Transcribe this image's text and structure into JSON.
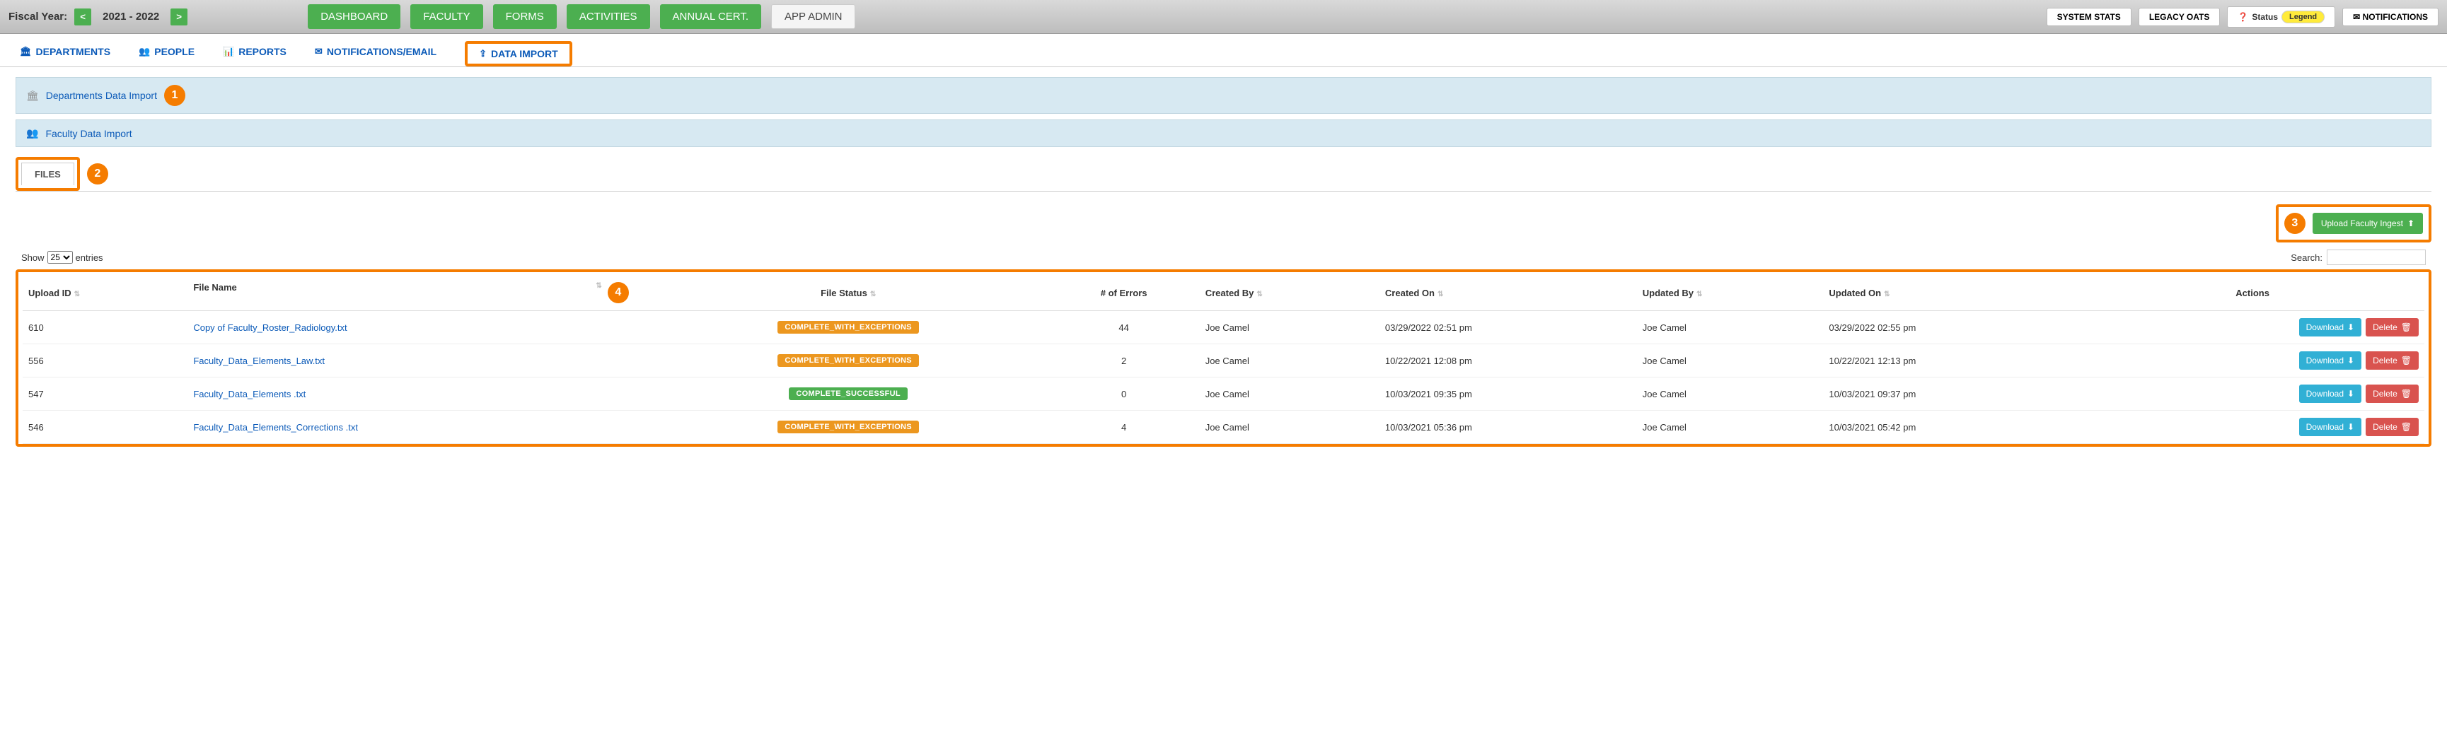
{
  "header": {
    "fiscal_label": "Fiscal Year:",
    "prev": "<",
    "year": "2021 - 2022",
    "next": ">",
    "nav": [
      "DASHBOARD",
      "FACULTY",
      "FORMS",
      "ACTIVITIES",
      "ANNUAL CERT.",
      "APP ADMIN"
    ],
    "util": {
      "system_stats": "SYSTEM STATS",
      "legacy_oats": "LEGACY OATS",
      "status_label": "Status",
      "legend": "Legend",
      "notifications": "NOTIFICATIONS"
    }
  },
  "tabs": {
    "departments": "DEPARTMENTS",
    "people": "PEOPLE",
    "reports": "REPORTS",
    "notifications_email": "NOTIFICATIONS/EMAIL",
    "data_import": "DATA IMPORT"
  },
  "import_sections": {
    "departments": "Departments Data Import",
    "faculty": "Faculty Data Import"
  },
  "files_tab": "FILES",
  "upload_btn": "Upload Faculty Ingest",
  "markers": {
    "m1": "1",
    "m2": "2",
    "m3": "3",
    "m4": "4"
  },
  "table_controls": {
    "show": "Show",
    "entries": "entries",
    "page_size": "25",
    "search": "Search:"
  },
  "columns": {
    "upload_id": "Upload ID",
    "file_name": "File Name",
    "file_status": "File Status",
    "errors": "# of Errors",
    "created_by": "Created By",
    "created_on": "Created On",
    "updated_by": "Updated By",
    "updated_on": "Updated On",
    "actions": "Actions"
  },
  "status_labels": {
    "exceptions": "COMPLETE_WITH_EXCEPTIONS",
    "successful": "COMPLETE_SUCCESSFUL"
  },
  "action_labels": {
    "download": "Download",
    "delete": "Delete"
  },
  "rows": [
    {
      "id": "610",
      "file": "Copy of Faculty_Roster_Radiology.txt",
      "status": "exceptions",
      "errors": "44",
      "created_by": "Joe Camel",
      "created_on": "03/29/2022 02:51 pm",
      "updated_by": "Joe Camel",
      "updated_on": "03/29/2022 02:55 pm"
    },
    {
      "id": "556",
      "file": "Faculty_Data_Elements_Law.txt",
      "status": "exceptions",
      "errors": "2",
      "created_by": "Joe Camel",
      "created_on": "10/22/2021 12:08 pm",
      "updated_by": "Joe Camel",
      "updated_on": "10/22/2021 12:13 pm"
    },
    {
      "id": "547",
      "file": "Faculty_Data_Elements .txt",
      "status": "successful",
      "errors": "0",
      "created_by": "Joe Camel",
      "created_on": "10/03/2021 09:35 pm",
      "updated_by": "Joe Camel",
      "updated_on": "10/03/2021 09:37 pm"
    },
    {
      "id": "546",
      "file": "Faculty_Data_Elements_Corrections .txt",
      "status": "exceptions",
      "errors": "4",
      "created_by": "Joe Camel",
      "created_on": "10/03/2021 05:36 pm",
      "updated_by": "Joe Camel",
      "updated_on": "10/03/2021 05:42 pm"
    }
  ]
}
